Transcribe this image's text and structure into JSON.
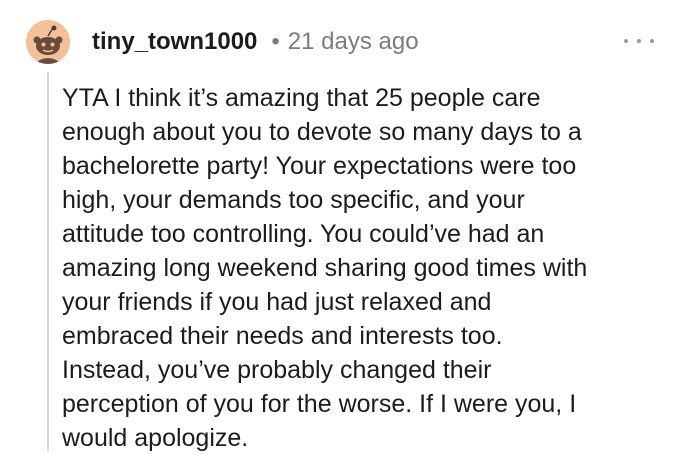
{
  "comment": {
    "avatar_icon": "reddit-snoo-avatar-icon",
    "username": "tiny_town1000",
    "separator": "•",
    "timestamp": "21 days ago",
    "more_icon": "more-options-icon",
    "body_lines": [
      "YTA I think it’s amazing that 25 people care",
      "enough about you to devote so many days to a",
      "bachelorette party! Your expectations were too",
      "high, your demands too specific, and your",
      "attitude too controlling. You could’ve had an",
      "amazing long weekend sharing good times with",
      "your friends if you had just relaxed and",
      "embraced their needs and interests too.",
      "Instead, you’ve probably changed their",
      "perception of you for the worse. If I were you, I",
      "would apologize."
    ]
  },
  "colors": {
    "avatar_background": "#f4c09a",
    "username_text": "#1c1c1c",
    "meta_text": "#7c7c7c",
    "thread_line": "#d8d8d8"
  }
}
